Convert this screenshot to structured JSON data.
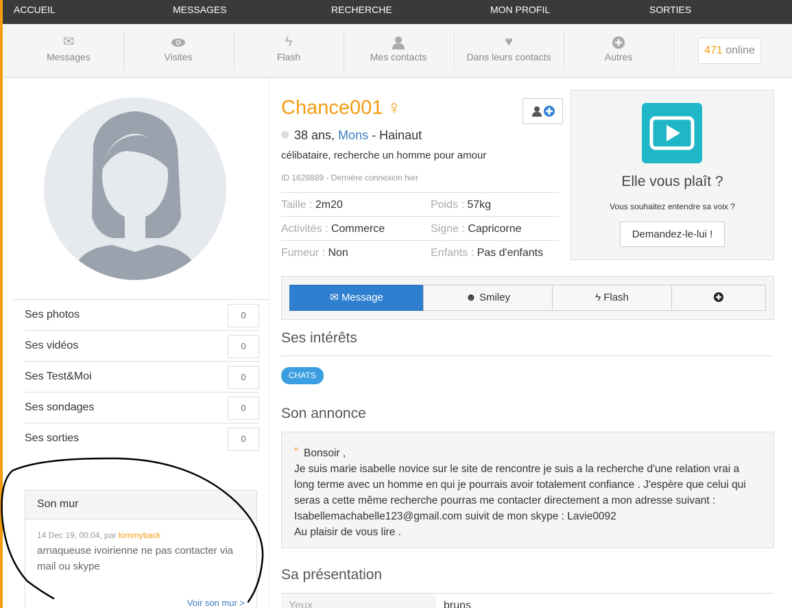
{
  "topnav": [
    "ACCUEIL",
    "MESSAGES",
    "RECHERCHE",
    "MON PROFIL",
    "SORTIES"
  ],
  "subnav": [
    {
      "label": "Messages",
      "icon": "envelope-icon"
    },
    {
      "label": "Visites",
      "icon": "eye-icon"
    },
    {
      "label": "Flash",
      "icon": "bolt-icon"
    },
    {
      "label": "Mes contacts",
      "icon": "user-icon"
    },
    {
      "label": "Dans leurs contacts",
      "icon": "heart-icon"
    },
    {
      "label": "Autres",
      "icon": "plus-circle-icon"
    }
  ],
  "online": {
    "count": "471",
    "label": "online"
  },
  "left": {
    "stats": [
      {
        "label": "Ses photos",
        "count": "0"
      },
      {
        "label": "Ses vidéos",
        "count": "0"
      },
      {
        "label": "Ses Test&Moi",
        "count": "0"
      },
      {
        "label": "Ses sondages",
        "count": "0"
      },
      {
        "label": "Ses sorties",
        "count": "0"
      }
    ],
    "wall": {
      "title": "Son mur",
      "date": "14 Dec 19, 00:04",
      "par": ", par ",
      "user": "tommyback",
      "text": "arnaqueuse ivoirienne ne pas contacter via mail ou skype",
      "link": "Voir son mur >"
    }
  },
  "profile": {
    "name": "Chance001",
    "gender_symbol": "♀",
    "age": "38 ans,",
    "city": "Mons",
    "region": "- Hainaut",
    "status": "célibataire, recherche un homme pour amour",
    "id_line": "ID 1628889 - Dernière connexion hier",
    "attrs": [
      [
        {
          "k": "Taille",
          "v": "2m20"
        },
        {
          "k": "Poids",
          "v": "57kg"
        }
      ],
      [
        {
          "k": "Activités",
          "v": "Commerce"
        },
        {
          "k": "Signe",
          "v": "Capricorne"
        }
      ],
      [
        {
          "k": "Fumeur",
          "v": "Non"
        },
        {
          "k": "Enfants",
          "v": "Pas d'enfants"
        }
      ]
    ]
  },
  "voice": {
    "title": "Elle vous plaît ?",
    "subtitle": "Vous souhaitez entendre sa voix ?",
    "button": "Demandez-le-lui !"
  },
  "actions": [
    {
      "label": "Message",
      "icon": "envelope-icon"
    },
    {
      "label": "Smiley",
      "icon": "smiley-icon"
    },
    {
      "label": "Flash",
      "icon": "bolt-icon"
    },
    {
      "label": "",
      "icon": "plus-circle-icon"
    }
  ],
  "interests": {
    "title": "Ses intérêts",
    "tags": [
      "CHATS"
    ]
  },
  "annonce": {
    "title": "Son annonce",
    "greeting": "Bonsoir ,",
    "body": "Je suis marie isabelle novice sur le site de rencontre je suis a la recherche d'une relation vrai a long terme avec un homme en qui je pourrais avoir totalement confiance . J'espère que celui qui seras a cette même recherche pourras me contacter directement a mon adresse suivant : Isabellemachabelle123@gmail.com suivit de mon skype : Lavie0092",
    "closing": "Au plaisir de vous lire ."
  },
  "presentation": {
    "title": "Sa présentation",
    "row": {
      "k": "Yeux",
      "v": "bruns"
    }
  }
}
